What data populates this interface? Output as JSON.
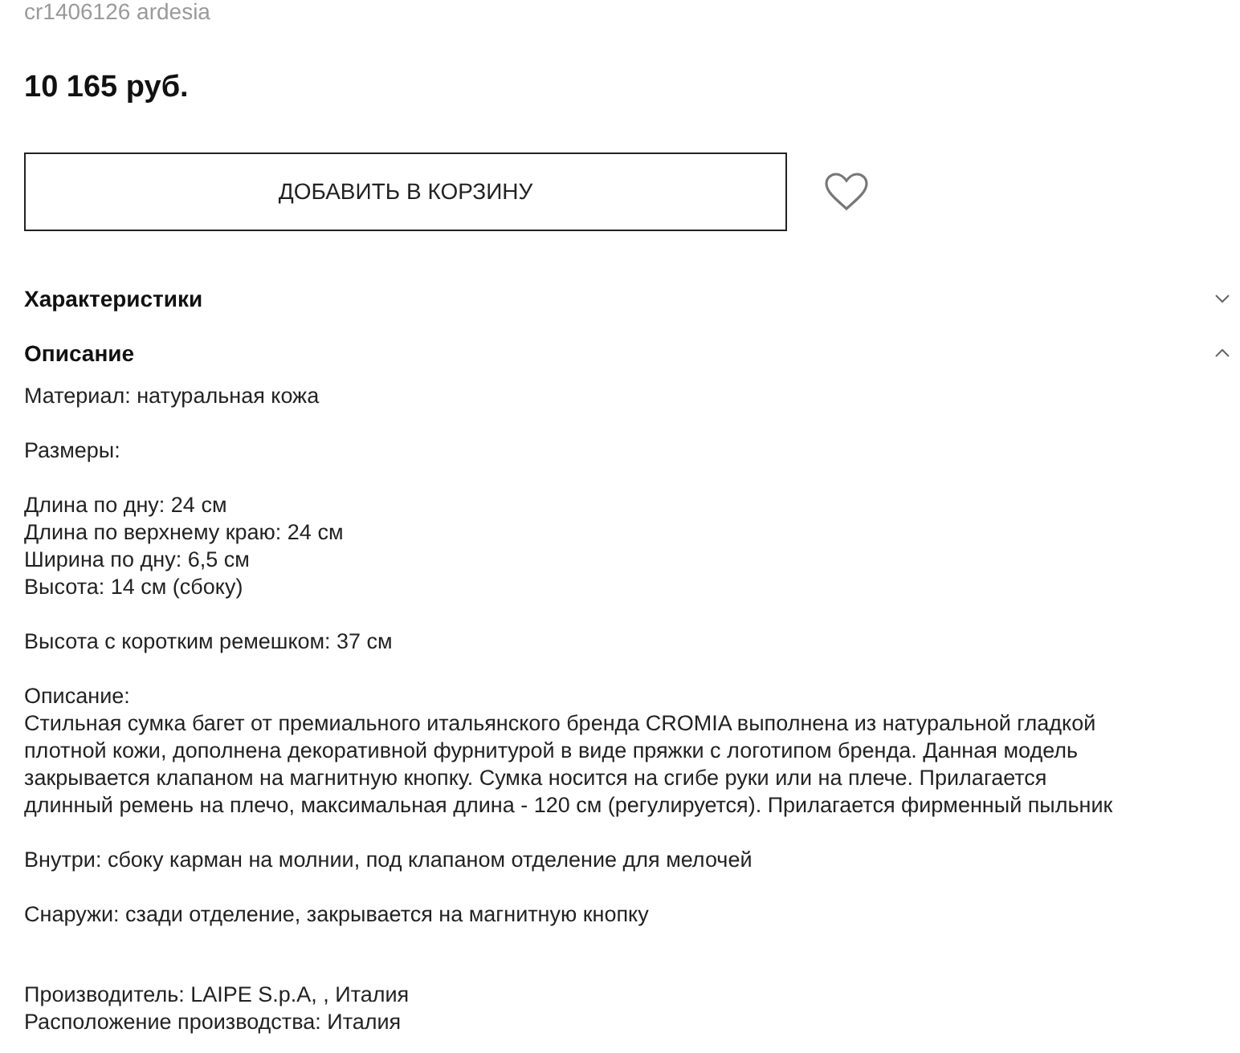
{
  "sku": "cr1406126 ardesia",
  "price": "10 165 руб.",
  "add_to_cart": "ДОБАВИТЬ В КОРЗИНУ",
  "sections": [
    {
      "title": "Характеристики",
      "expanded": false
    },
    {
      "title": "Описание",
      "expanded": true,
      "paragraphs": [
        [
          "Материал: натуральная кожа"
        ],
        [
          "Размеры:"
        ],
        [
          "Длина по дну: 24 см",
          "Длина по верхнему краю: 24 см",
          "Ширина по дну: 6,5 см",
          "Высота: 14 см (сбоку)"
        ],
        [
          "Высота с коротким ремешком: 37 см"
        ],
        [
          "Описание:",
          "Стильная сумка багет от премиального итальянского бренда CROMIA выполнена из натуральной гладкой",
          "плотной кожи, дополнена декоративной фурнитурой в виде пряжки с логотипом бренда. Данная модель",
          "закрывается клапаном на магнитную кнопку. Сумка носится на сгибе руки или на плече. Прилагается",
          "длинный ремень на плечо, максимальная длина - 120 см (регулируется). Прилагается фирменный пыльник"
        ],
        [
          "Внутри: сбоку карман на молнии, под клапаном отделение для мелочей"
        ],
        [
          "Снаружи: сзади отделение, закрывается на магнитную кнопку"
        ],
        [
          "Производитель: LAIPE S.p.A, , Италия",
          "Расположение производства: Италия"
        ]
      ]
    }
  ]
}
